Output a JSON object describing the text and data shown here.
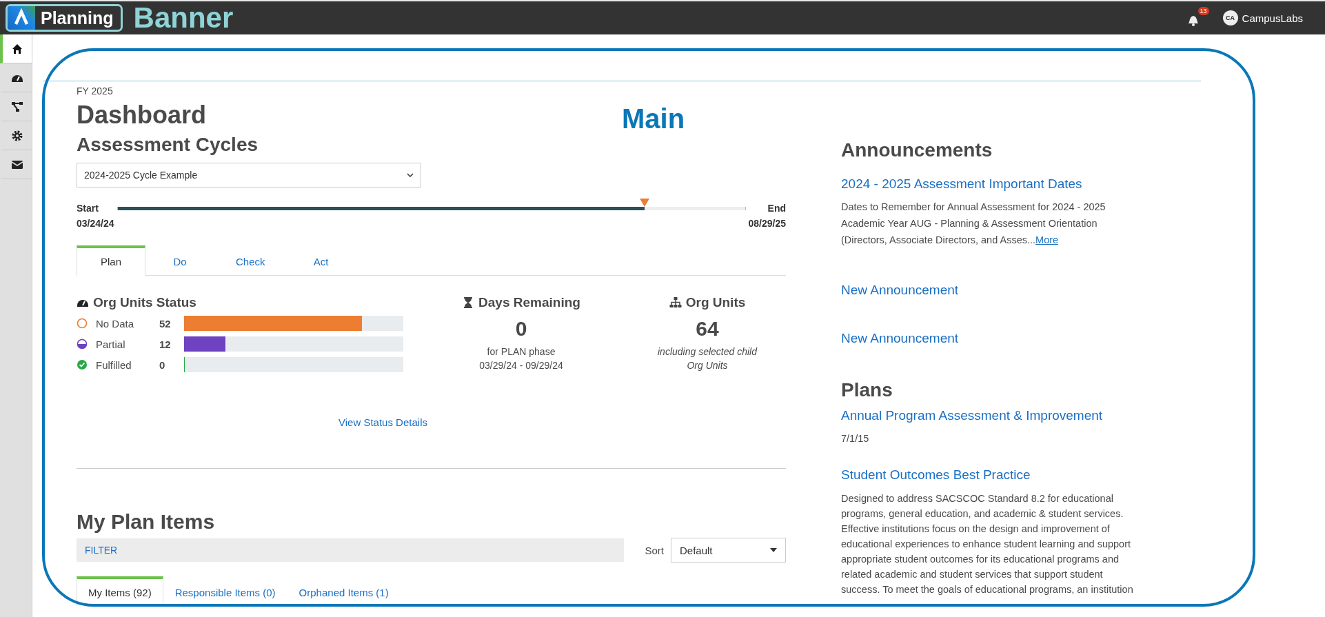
{
  "annotations": {
    "banner": "Banner",
    "main": "Main"
  },
  "banner": {
    "app_name": "Planning",
    "notifications": "13",
    "avatar": "CA",
    "user": "CampusLabs"
  },
  "sidebar": {
    "items": [
      {
        "selected": true
      },
      {
        "selected": false
      },
      {
        "selected": false
      },
      {
        "selected": false
      },
      {
        "selected": false
      }
    ]
  },
  "fiscal_year": "FY 2025",
  "title": "Dashboard",
  "cycles": {
    "heading": "Assessment Cycles",
    "select": "2024-2025 Cycle Example",
    "timeline": {
      "start_label": "Start",
      "start_date": "03/24/24",
      "end_label": "End",
      "end_date": "08/29/25",
      "level": 0.84
    },
    "tabs": [
      {
        "label": "Plan",
        "selected": true
      },
      {
        "label": "Do",
        "selected": false
      },
      {
        "label": "Check",
        "selected": false
      },
      {
        "label": "Act",
        "selected": false
      }
    ]
  },
  "status": {
    "heading": "Org Units Status",
    "rows": [
      {
        "kind": "none",
        "label": "No Data",
        "count": "52",
        "level": 0.81,
        "color": "#ed7d31"
      },
      {
        "kind": "partial",
        "label": "Partial",
        "count": "12",
        "level": 0.19,
        "color": "#6f42c1"
      },
      {
        "kind": "fulfilled",
        "label": "Fulfilled",
        "count": "0",
        "level": 0,
        "color": "#28a745"
      }
    ]
  },
  "days": {
    "heading": "Days Remaining",
    "value": "0",
    "caption": "for PLAN phase",
    "range": "03/29/24 - 09/29/24"
  },
  "org_units": {
    "heading": "Org Units",
    "value": "64",
    "caption": "including selected child Org Units"
  },
  "view_details": "View Status Details",
  "plan_items": {
    "heading": "My Plan Items",
    "filter": "FILTER",
    "sort_label": "Sort",
    "sort_value": "Default",
    "tabs": [
      {
        "label": "My Items (92)",
        "selected": true
      },
      {
        "label": "Responsible Items (0)",
        "selected": false
      },
      {
        "label": "Orphaned Items (1)",
        "selected": false
      }
    ]
  },
  "announcements": {
    "heading": "Announcements",
    "items": [
      {
        "title": "2024 - 2025 Assessment Important Dates",
        "description": "Dates to Remember for Annual Assessment for 2024 - 2025 Academic Year AUG -  Planning & Assessment Orientation (Directors, Associate Directors, and Asses...",
        "more": "More"
      },
      {
        "title": "New Announcement"
      },
      {
        "title": "New Announcement"
      }
    ]
  },
  "plans": {
    "heading": "Plans",
    "items": [
      {
        "title": "Annual Program Assessment & Improvement",
        "date": "7/1/15"
      },
      {
        "title": "Student Outcomes Best Practice",
        "description": "Designed to address SACSCOC Standard 8.2 for educational programs, general education, and academic & student services. Effective institutions focus on the design and improvement of educational experiences to enhance student learning and support appropriate student outcomes for its educational programs and related academic and student services that support student success. To meet the goals of educational programs, an institution"
      }
    ]
  }
}
